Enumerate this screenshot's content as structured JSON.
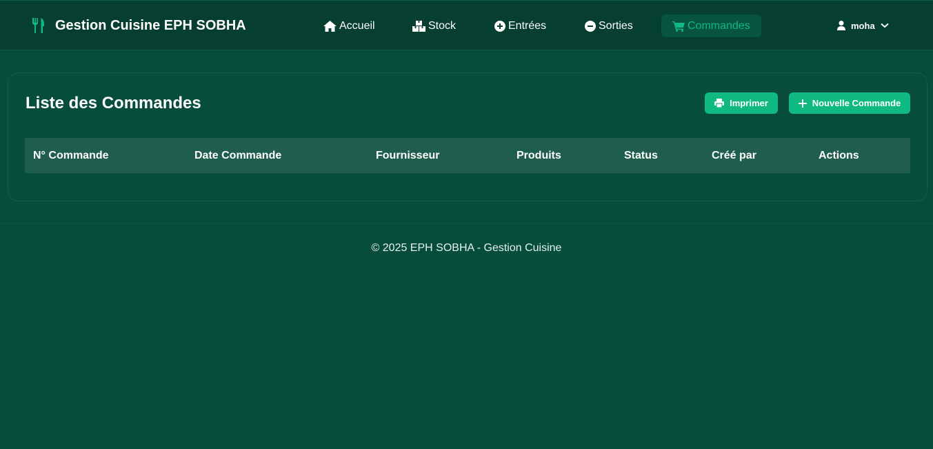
{
  "header": {
    "brand_icon": "utensils-icon",
    "brand_title": "Gestion Cuisine EPH SOBHA",
    "accent_color": "#10b981"
  },
  "nav": {
    "items": [
      {
        "label": "Accueil",
        "icon": "home-icon"
      },
      {
        "label": "Stock",
        "icon": "boxes-icon"
      },
      {
        "label": "Entrées",
        "icon": "plus-circle-icon"
      },
      {
        "label": "Sorties",
        "icon": "minus-circle-icon"
      },
      {
        "label": "Commandes",
        "icon": "cart-icon",
        "active": true
      }
    ]
  },
  "user": {
    "name": "moha",
    "icon": "user-icon",
    "dropdown_icon": "chevron-down-icon"
  },
  "main": {
    "title": "Liste des Commandes",
    "print_label": "Imprimer",
    "new_label": "Nouvelle Commande",
    "columns": [
      "N° Commande",
      "Date Commande",
      "Fournisseur",
      "Produits",
      "Status",
      "Créé par",
      "Actions"
    ]
  },
  "footer": {
    "text": "© 2025 EPH SOBHA - Gestion Cuisine"
  }
}
